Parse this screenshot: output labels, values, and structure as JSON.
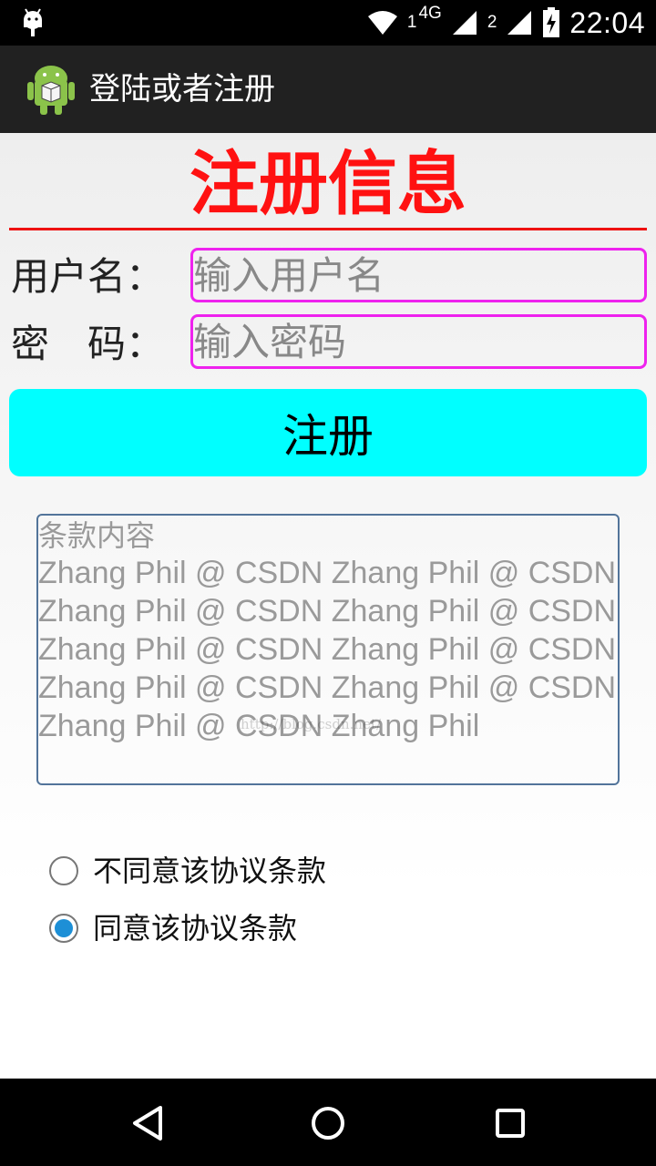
{
  "status_bar": {
    "time": "22:04",
    "network_type": "4G",
    "sim1_label": "1",
    "sim2_label": "2",
    "icons": [
      "android-debug-icon",
      "wifi-icon",
      "signal-sim1-icon",
      "signal-sim2-icon",
      "battery-charging-icon"
    ]
  },
  "app_bar": {
    "title": "登陆或者注册",
    "icon": "android-app-icon"
  },
  "form": {
    "heading": "注册信息",
    "username_label": "用户名：",
    "username_placeholder": "输入用户名",
    "password_label": "密　码：",
    "password_placeholder": "输入密码",
    "register_button": "注册"
  },
  "terms": {
    "heading": "条款内容",
    "body": "Zhang Phil @ CSDN Zhang Phil @ CSDN Zhang Phil @ CSDN Zhang Phil @ CSDN Zhang Phil @ CSDN Zhang Phil @ CSDN Zhang Phil @ CSDN Zhang Phil @ CSDN Zhang Phil @ CSDN Zhang Phil",
    "watermark": "http://blog.csdn.net/"
  },
  "agreement": {
    "options": [
      {
        "label": "不同意该协议条款",
        "selected": false
      },
      {
        "label": "同意该协议条款",
        "selected": true
      }
    ]
  },
  "colors": {
    "heading": "#ff1111",
    "input_border": "#ee22ee",
    "button_bg": "#00ffff",
    "radio_selected": "#1d8fd6"
  },
  "nav_bar": {
    "buttons": [
      "back-icon",
      "home-icon",
      "recents-icon"
    ]
  }
}
